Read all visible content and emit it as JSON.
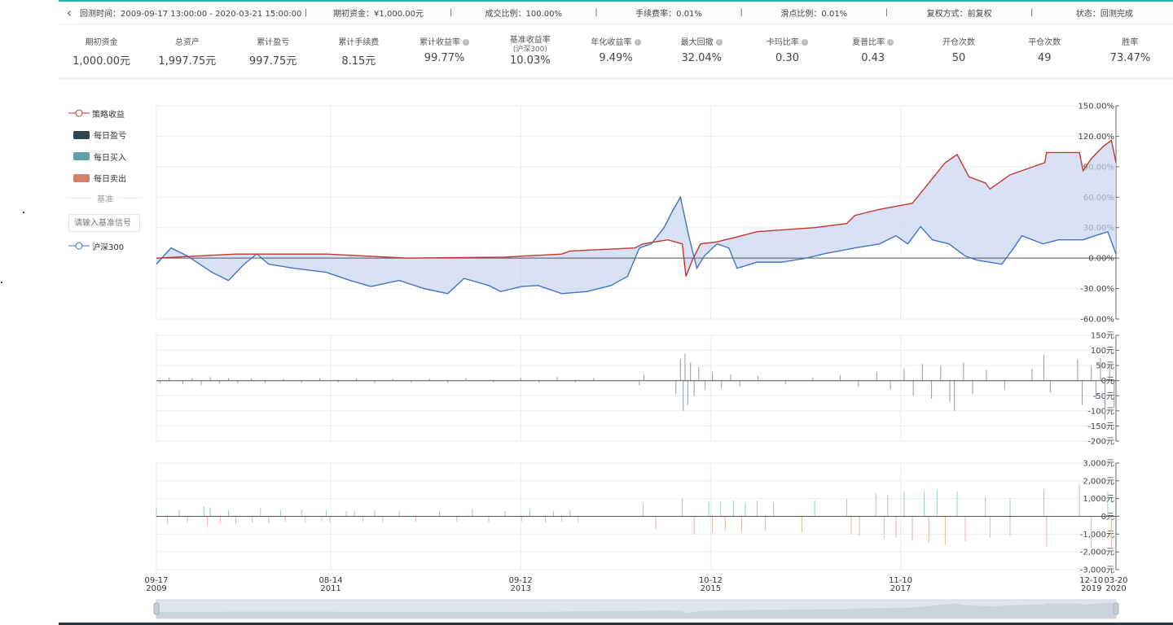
{
  "topbar": {
    "items": [
      "回测时间：2009-09-17 13:00:00 - 2020-03-21 15:00:00",
      "期初资金：¥1,000.00元",
      "成交比例：100.00%",
      "手续费率：0.01%",
      "滑点比例：0.01%",
      "复权方式：前复权",
      "状态：回测完成"
    ]
  },
  "stats": [
    {
      "label": "期初资金",
      "value": "1,000.00元"
    },
    {
      "label": "总资产",
      "value": "1,997.75元"
    },
    {
      "label": "累计盈亏",
      "value": "997.75元"
    },
    {
      "label": "累计手续费",
      "value": "8.15元"
    },
    {
      "label": "累计收益率",
      "value": "99.77%",
      "info": true
    },
    {
      "label": "基准收益率",
      "sub": "(沪深300)",
      "value": "10.03%"
    },
    {
      "label": "年化收益率",
      "value": "9.49%",
      "info": true
    },
    {
      "label": "最大回撤",
      "value": "32.04%",
      "info": true
    },
    {
      "label": "卡玛比率",
      "value": "0.30",
      "info": true
    },
    {
      "label": "夏普比率",
      "value": "0.43",
      "info": true
    },
    {
      "label": "开仓次数",
      "value": "50"
    },
    {
      "label": "平仓次数",
      "value": "49"
    },
    {
      "label": "胜率",
      "value": "73.47%"
    }
  ],
  "legend": {
    "strategy": "策略收益",
    "daily_pnl": "每日盈亏",
    "daily_buy": "每日买入",
    "daily_sell": "每日卖出",
    "benchmark_header": "基准",
    "benchmark_placeholder": "请输入基准信号",
    "benchmark": "沪深300"
  },
  "colors": {
    "strategy": "#c23531",
    "benchmark": "#4472c4",
    "pnl": "#2f4554",
    "buy": "#61a0a8",
    "sell": "#d48265",
    "accent": "#1fb5ad"
  },
  "chart_data": [
    {
      "type": "line",
      "title": "收益",
      "ylim": [
        -60,
        150
      ],
      "yticks": [
        "150.00%",
        "120.00%",
        "90.00%",
        "60.00%",
        "30.00%",
        "0.00%",
        "-30.00%",
        "-60.00%"
      ],
      "series": [
        {
          "name": "策略收益",
          "points": [
            [
              2009.71,
              0
            ],
            [
              2010.58,
              4
            ],
            [
              2011.57,
              4
            ],
            [
              2012.46,
              0
            ],
            [
              2013.53,
              1
            ],
            [
              2014.15,
              4
            ],
            [
              2014.24,
              7
            ],
            [
              2014.95,
              10
            ],
            [
              2015.04,
              14
            ],
            [
              2015.31,
              18
            ],
            [
              2015.47,
              14
            ],
            [
              2015.51,
              -18
            ],
            [
              2015.58,
              -2
            ],
            [
              2015.67,
              14
            ],
            [
              2015.85,
              16
            ],
            [
              2016.03,
              20
            ],
            [
              2016.29,
              26
            ],
            [
              2016.92,
              30
            ],
            [
              2017.27,
              34
            ],
            [
              2017.36,
              42
            ],
            [
              2017.63,
              48
            ],
            [
              2017.99,
              54
            ],
            [
              2018.17,
              74
            ],
            [
              2018.35,
              94
            ],
            [
              2018.48,
              102
            ],
            [
              2018.61,
              80
            ],
            [
              2018.79,
              74
            ],
            [
              2018.84,
              68
            ],
            [
              2019.06,
              82
            ],
            [
              2019.44,
              94
            ],
            [
              2019.46,
              104
            ],
            [
              2019.82,
              104
            ],
            [
              2019.86,
              86
            ],
            [
              2019.95,
              98
            ],
            [
              2020.08,
              110
            ],
            [
              2020.17,
              116
            ],
            [
              2020.22,
              94
            ]
          ]
        },
        {
          "name": "沪深300",
          "points": [
            [
              2009.71,
              -6
            ],
            [
              2009.87,
              10
            ],
            [
              2010.05,
              2
            ],
            [
              2010.32,
              -14
            ],
            [
              2010.5,
              -22
            ],
            [
              2010.67,
              -6
            ],
            [
              2010.81,
              4
            ],
            [
              2010.94,
              -6
            ],
            [
              2011.21,
              -10
            ],
            [
              2011.57,
              -14
            ],
            [
              2011.83,
              -22
            ],
            [
              2012.06,
              -28
            ],
            [
              2012.37,
              -22
            ],
            [
              2012.64,
              -30
            ],
            [
              2012.9,
              -35
            ],
            [
              2013.08,
              -20
            ],
            [
              2013.35,
              -27
            ],
            [
              2013.48,
              -33
            ],
            [
              2013.71,
              -28
            ],
            [
              2013.89,
              -27
            ],
            [
              2014.15,
              -35
            ],
            [
              2014.42,
              -33
            ],
            [
              2014.69,
              -27
            ],
            [
              2014.87,
              -18
            ],
            [
              2015.0,
              10
            ],
            [
              2015.13,
              14
            ],
            [
              2015.27,
              30
            ],
            [
              2015.36,
              46
            ],
            [
              2015.45,
              60
            ],
            [
              2015.54,
              22
            ],
            [
              2015.63,
              -10
            ],
            [
              2015.71,
              2
            ],
            [
              2015.85,
              14
            ],
            [
              2015.98,
              10
            ],
            [
              2016.07,
              -10
            ],
            [
              2016.29,
              -4
            ],
            [
              2016.56,
              -4
            ],
            [
              2016.83,
              0
            ],
            [
              2017.01,
              4
            ],
            [
              2017.36,
              10
            ],
            [
              2017.63,
              14
            ],
            [
              2017.81,
              22
            ],
            [
              2017.94,
              14
            ],
            [
              2018.08,
              31
            ],
            [
              2018.21,
              18
            ],
            [
              2018.39,
              14
            ],
            [
              2018.57,
              2
            ],
            [
              2018.7,
              -2
            ],
            [
              2018.97,
              -6
            ],
            [
              2019.1,
              10
            ],
            [
              2019.19,
              22
            ],
            [
              2019.42,
              14
            ],
            [
              2019.59,
              18
            ],
            [
              2019.86,
              18
            ],
            [
              2019.99,
              22
            ],
            [
              2020.13,
              26
            ],
            [
              2020.22,
              4
            ]
          ]
        }
      ]
    },
    {
      "type": "bar",
      "title": "每日盈亏",
      "ylim": [
        -200,
        150
      ],
      "yticks": [
        "150元",
        "100元",
        "50元",
        "0元",
        "-50元",
        "-100元",
        "-150元",
        "-200元"
      ],
      "values": [
        [
          2009.75,
          -8
        ],
        [
          2009.85,
          10
        ],
        [
          2010.0,
          -12
        ],
        [
          2010.1,
          8
        ],
        [
          2010.2,
          -15
        ],
        [
          2010.3,
          12
        ],
        [
          2010.4,
          -10
        ],
        [
          2010.5,
          8
        ],
        [
          2010.6,
          -9
        ],
        [
          2010.75,
          7
        ],
        [
          2010.9,
          -8
        ],
        [
          2011.1,
          6
        ],
        [
          2011.3,
          -7
        ],
        [
          2011.5,
          8
        ],
        [
          2011.7,
          -6
        ],
        [
          2011.9,
          7
        ],
        [
          2012.1,
          -8
        ],
        [
          2012.3,
          6
        ],
        [
          2012.5,
          -5
        ],
        [
          2012.7,
          6
        ],
        [
          2012.9,
          -7
        ],
        [
          2013.1,
          8
        ],
        [
          2013.4,
          -6
        ],
        [
          2013.7,
          9
        ],
        [
          2013.9,
          -7
        ],
        [
          2014.1,
          12
        ],
        [
          2014.3,
          -6
        ],
        [
          2014.5,
          8
        ],
        [
          2015.0,
          -15
        ],
        [
          2015.05,
          20
        ],
        [
          2015.4,
          -45
        ],
        [
          2015.45,
          70
        ],
        [
          2015.48,
          -100
        ],
        [
          2015.5,
          90
        ],
        [
          2015.53,
          -80
        ],
        [
          2015.56,
          60
        ],
        [
          2015.6,
          -50
        ],
        [
          2015.65,
          45
        ],
        [
          2015.72,
          -30
        ],
        [
          2015.8,
          30
        ],
        [
          2015.9,
          -25
        ],
        [
          2016.0,
          20
        ],
        [
          2016.1,
          -20
        ],
        [
          2016.3,
          15
        ],
        [
          2016.6,
          -12
        ],
        [
          2016.9,
          10
        ],
        [
          2017.2,
          18
        ],
        [
          2017.4,
          -20
        ],
        [
          2017.6,
          30
        ],
        [
          2017.75,
          -30
        ],
        [
          2017.9,
          40
        ],
        [
          2018.0,
          -50
        ],
        [
          2018.1,
          55
        ],
        [
          2018.2,
          -60
        ],
        [
          2018.3,
          50
        ],
        [
          2018.4,
          -70
        ],
        [
          2018.45,
          -100
        ],
        [
          2018.55,
          60
        ],
        [
          2018.65,
          -45
        ],
        [
          2018.8,
          35
        ],
        [
          2019.0,
          -30
        ],
        [
          2019.3,
          40
        ],
        [
          2019.43,
          85
        ],
        [
          2019.5,
          -40
        ],
        [
          2019.8,
          70
        ],
        [
          2019.85,
          -80
        ],
        [
          2019.95,
          50
        ],
        [
          2020.0,
          -60
        ],
        [
          2020.05,
          75
        ],
        [
          2020.1,
          -130
        ],
        [
          2020.15,
          55
        ],
        [
          2020.2,
          -90
        ]
      ]
    },
    {
      "type": "bar",
      "title": "每日买入/卖出",
      "ylim": [
        -3000,
        3000
      ],
      "yticks": [
        "3,000元",
        "2,000元",
        "1,000元",
        "0元",
        "-1,000元",
        "-2,000元",
        "-3,000元"
      ],
      "buys": [
        [
          2009.71,
          500
        ],
        [
          2009.96,
          400
        ],
        [
          2010.23,
          550
        ],
        [
          2010.3,
          500
        ],
        [
          2010.5,
          350
        ],
        [
          2010.85,
          450
        ],
        [
          2011.07,
          350
        ],
        [
          2011.3,
          400
        ],
        [
          2011.57,
          350
        ],
        [
          2011.79,
          300
        ],
        [
          2011.88,
          300
        ],
        [
          2012.1,
          350
        ],
        [
          2012.37,
          300
        ],
        [
          2012.81,
          300
        ],
        [
          2013.17,
          400
        ],
        [
          2013.53,
          300
        ],
        [
          2013.8,
          350
        ],
        [
          2014.06,
          300
        ],
        [
          2014.24,
          350
        ],
        [
          2015.04,
          700
        ],
        [
          2015.47,
          1000
        ],
        [
          2015.76,
          800
        ],
        [
          2015.89,
          800
        ],
        [
          2016.03,
          900
        ],
        [
          2016.16,
          800
        ],
        [
          2016.29,
          900
        ],
        [
          2016.47,
          800
        ],
        [
          2016.92,
          900
        ],
        [
          2017.27,
          1000
        ],
        [
          2017.59,
          1300
        ],
        [
          2017.72,
          1200
        ],
        [
          2017.9,
          1400
        ],
        [
          2018.12,
          1400
        ],
        [
          2018.26,
          1500
        ],
        [
          2018.48,
          1400
        ],
        [
          2018.79,
          1100
        ],
        [
          2019.06,
          1000
        ],
        [
          2019.43,
          1500
        ],
        [
          2019.82,
          1800
        ],
        [
          2020.13,
          1400
        ]
      ],
      "sells": [
        [
          2009.83,
          -400
        ],
        [
          2010.05,
          -350
        ],
        [
          2010.27,
          -500
        ],
        [
          2010.41,
          -400
        ],
        [
          2010.58,
          -450
        ],
        [
          2010.76,
          -350
        ],
        [
          2010.94,
          -400
        ],
        [
          2011.12,
          -300
        ],
        [
          2011.34,
          -350
        ],
        [
          2011.52,
          -300
        ],
        [
          2011.61,
          -350
        ],
        [
          2011.97,
          -300
        ],
        [
          2012.19,
          -350
        ],
        [
          2012.55,
          -300
        ],
        [
          2013.0,
          -300
        ],
        [
          2013.35,
          -350
        ],
        [
          2013.71,
          -300
        ],
        [
          2013.97,
          -350
        ],
        [
          2014.15,
          -300
        ],
        [
          2014.33,
          -350
        ],
        [
          2015.18,
          -700
        ],
        [
          2015.6,
          -1000
        ],
        [
          2015.8,
          -900
        ],
        [
          2015.94,
          -800
        ],
        [
          2016.12,
          -900
        ],
        [
          2016.38,
          -800
        ],
        [
          2016.78,
          -900
        ],
        [
          2017.32,
          -1000
        ],
        [
          2017.41,
          -1100
        ],
        [
          2017.68,
          -1300
        ],
        [
          2017.81,
          -1200
        ],
        [
          2017.99,
          -1400
        ],
        [
          2018.17,
          -1500
        ],
        [
          2018.35,
          -1600
        ],
        [
          2018.57,
          -1400
        ],
        [
          2018.84,
          -1200
        ],
        [
          2019.06,
          -1100
        ],
        [
          2019.46,
          -1700
        ],
        [
          2019.95,
          -1800
        ],
        [
          2020.17,
          -1700
        ]
      ]
    }
  ],
  "xaxis": {
    "range": [
      2009.71,
      2020.22
    ],
    "ticks": [
      {
        "t": 2009.71,
        "md": "09-17",
        "y": "2009"
      },
      {
        "t": 2011.62,
        "md": "08-14",
        "y": "2011"
      },
      {
        "t": 2013.7,
        "md": "09-12",
        "y": "2013"
      },
      {
        "t": 2015.78,
        "md": "10-12",
        "y": "2015"
      },
      {
        "t": 2017.86,
        "md": "11-10",
        "y": "2017"
      },
      {
        "t": 2019.95,
        "md": "12-10",
        "y": "2019"
      },
      {
        "t": 2020.22,
        "md": "03-20",
        "y": "2020"
      }
    ]
  }
}
